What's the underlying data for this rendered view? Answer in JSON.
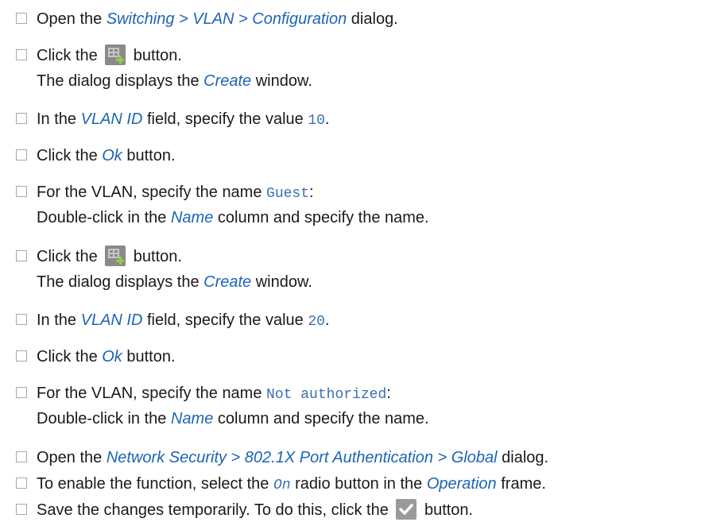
{
  "steps": [
    {
      "pre": "Open the ",
      "ui": "Switching > VLAN > Configuration",
      "post": " dialog."
    },
    {
      "pre": "Click the ",
      "post": " button.",
      "line2_pre": "The dialog displays the ",
      "line2_ui": "Create",
      "line2_post": " window."
    },
    {
      "pre": "In the ",
      "ui": "VLAN ID",
      "mid": " field, specify the value ",
      "code": "10",
      "post": "."
    },
    {
      "pre": "Click the ",
      "ui": "Ok",
      "post": " button."
    },
    {
      "pre": "For the VLAN, specify the name ",
      "code": "Guest",
      "post": ":",
      "line2_pre": "Double-click in the ",
      "line2_ui": "Name",
      "line2_post": " column and specify the name."
    },
    {
      "pre": "Click the ",
      "post": " button.",
      "line2_pre": "The dialog displays the ",
      "line2_ui": "Create",
      "line2_post": " window."
    },
    {
      "pre": "In the ",
      "ui": "VLAN ID",
      "mid": " field, specify the value ",
      "code": "20",
      "post": "."
    },
    {
      "pre": "Click the ",
      "ui": "Ok",
      "post": " button."
    },
    {
      "pre": "For the VLAN, specify the name ",
      "code": "Not authorized",
      "post": ":",
      "line2_pre": "Double-click in the ",
      "line2_ui": "Name",
      "line2_post": " column and specify the name."
    },
    {
      "pre": "Open the ",
      "ui": "Network Security > 802.1X Port Authentication > Global",
      "post": " dialog."
    },
    {
      "pre": "To enable the function, select the ",
      "code": "On",
      "mid": " radio button in the ",
      "ui": "Operation",
      "post": " frame."
    },
    {
      "pre": "Save the changes temporarily. To do this, click the ",
      "post": " button."
    }
  ],
  "icons": {
    "create": "create-table-icon",
    "save": "checkmark-save-icon"
  },
  "colors": {
    "ui_text": "#1e64b4",
    "code_text": "#3a6fb0",
    "create_plus": "#8ed04a"
  }
}
